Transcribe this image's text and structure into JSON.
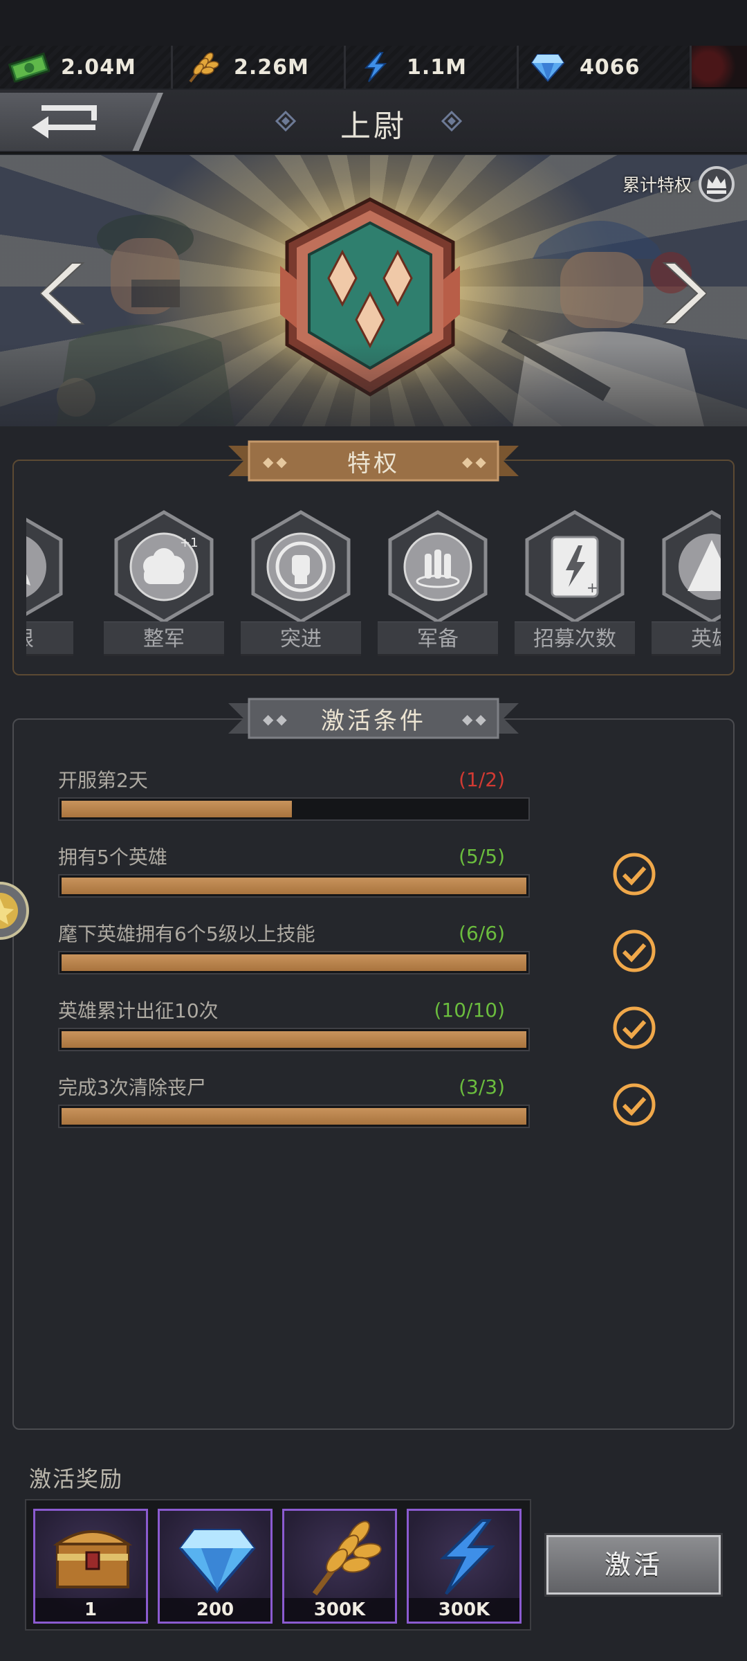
{
  "resources": [
    {
      "name": "cash",
      "icon": "cash-icon",
      "value": "2.04M"
    },
    {
      "name": "wheat",
      "icon": "wheat-icon",
      "value": "2.26M"
    },
    {
      "name": "energy",
      "icon": "lightning-icon",
      "value": "1.1M"
    },
    {
      "name": "diamond",
      "icon": "diamond-icon",
      "value": "4066"
    }
  ],
  "header": {
    "title": "上尉"
  },
  "banner": {
    "cumulative_privileges_label": "累计特权"
  },
  "privileges": {
    "title": "特权",
    "items": [
      {
        "label": "上限",
        "icon": "cap-icon"
      },
      {
        "label": "整军",
        "icon": "army-icon"
      },
      {
        "label": "突进",
        "icon": "fist-icon"
      },
      {
        "label": "军备",
        "icon": "ammo-icon"
      },
      {
        "label": "招募次数",
        "icon": "recruit-card-icon"
      },
      {
        "label": "英雄",
        "icon": "hero-tent-icon"
      }
    ]
  },
  "conditions": {
    "title": "激活条件",
    "items": [
      {
        "label": "开服第2天",
        "progress": "(1/2)",
        "fraction": 0.5,
        "status": "incomplete"
      },
      {
        "label": "拥有5个英雄",
        "progress": "(5/5)",
        "fraction": 1.0,
        "status": "complete"
      },
      {
        "label": "麾下英雄拥有6个5级以上技能",
        "progress": "(6/6)",
        "fraction": 1.0,
        "status": "complete"
      },
      {
        "label": "英雄累计出征10次",
        "progress": "(10/10)",
        "fraction": 1.0,
        "status": "complete"
      },
      {
        "label": "完成3次清除丧尸",
        "progress": "(3/3)",
        "fraction": 1.0,
        "status": "complete"
      }
    ]
  },
  "rewards": {
    "title": "激活奖励",
    "items": [
      {
        "icon": "treasure-chest-icon",
        "count": "1"
      },
      {
        "icon": "diamond-icon",
        "count": "200"
      },
      {
        "icon": "wheat-icon",
        "count": "300K"
      },
      {
        "icon": "lightning-icon",
        "count": "300K"
      }
    ]
  },
  "activate_button": "激活",
  "colors": {
    "progress_fill": "#b98350",
    "incomplete_text": "#d13a33",
    "complete_text": "#6bbd3e",
    "check": "#f0a84a",
    "reward_border": "#8b5bd0"
  }
}
